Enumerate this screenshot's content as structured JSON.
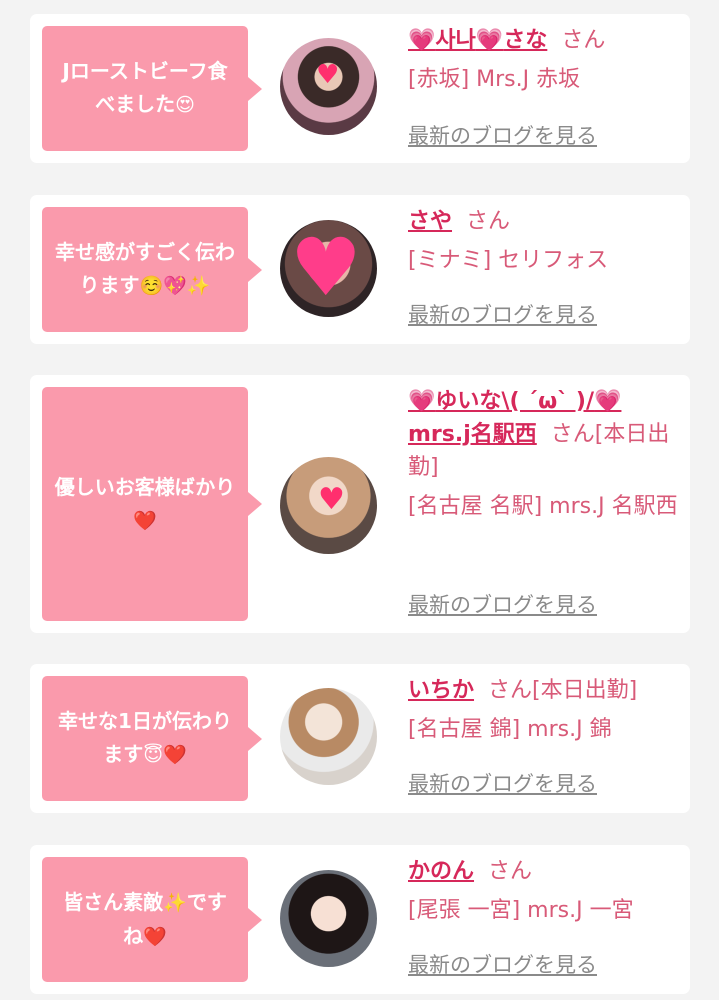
{
  "colors": {
    "bubble": "#fa9aac",
    "name": "#d6285a",
    "text": "#d85a78",
    "blog_link": "#8a8a8a"
  },
  "reviews": [
    {
      "comment_text": "Jローストビーフ食べました",
      "comment_emoji": "😍",
      "name_pre": "💗",
      "name": "사나",
      "name_mid": "💗",
      "name_post": "さな",
      "suffix": "さん",
      "shop": "[赤坂] Mrs.J 赤坂",
      "blog_link": "最新のブログを見る"
    },
    {
      "comment_text": "幸せ感がすごく伝わります",
      "comment_emoji": "☺️💖✨",
      "name": "さや",
      "suffix": "さん",
      "shop": "[ミナミ] セリフォス",
      "blog_link": "最新のブログを見る"
    },
    {
      "comment_text": "優しいお客様ばかり",
      "comment_emoji": "❤️",
      "name_pre": "💗",
      "name": "ゆいな\\( ´ω` )/",
      "name_mid": "💗",
      "name_post": "mrs.j名駅西",
      "suffix": "さん[本日出勤]",
      "shop": "[名古屋 名駅] mrs.J 名駅西",
      "blog_link": "最新のブログを見る"
    },
    {
      "comment_text": "幸せな1日が伝わります",
      "comment_emoji": "😇❤️",
      "name": "いちか",
      "suffix": "さん[本日出勤]",
      "shop": "[名古屋 錦] mrs.J 錦",
      "blog_link": "最新のブログを見る"
    },
    {
      "comment_text": "皆さん素敵",
      "comment_emoji": "✨",
      "comment_text2": "ですね",
      "comment_emoji2": "❤️",
      "name": "かのん",
      "suffix": "さん",
      "shop": "[尾張 一宮] mrs.J 一宮",
      "blog_link": "最新のブログを見る"
    }
  ]
}
